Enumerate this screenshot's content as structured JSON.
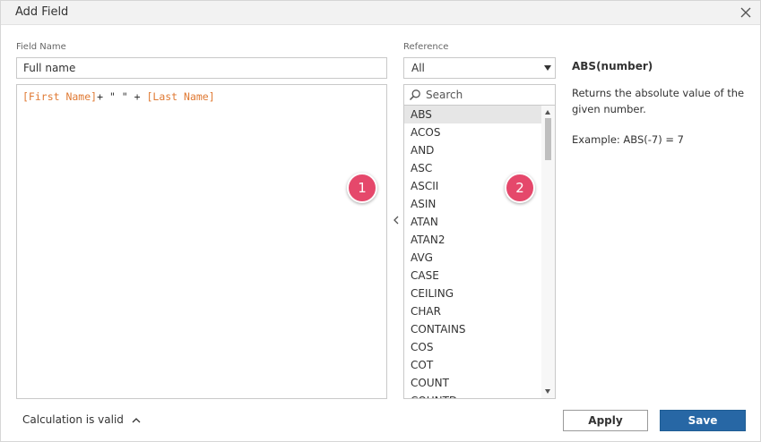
{
  "dialog": {
    "title": "Add Field",
    "close_icon": "close-icon"
  },
  "field_name": {
    "label": "Field Name",
    "value": "Full name"
  },
  "formula": {
    "ref1": "[First Name]",
    "op1": "+ \" \" + ",
    "ref2": "[Last Name]"
  },
  "callouts": {
    "one": "1",
    "two": "2"
  },
  "reference": {
    "label": "Reference",
    "selected": "All",
    "search_placeholder": "Search",
    "search_icon": "search-icon",
    "functions": [
      "ABS",
      "ACOS",
      "AND",
      "ASC",
      "ASCII",
      "ASIN",
      "ATAN",
      "ATAN2",
      "AVG",
      "CASE",
      "CEILING",
      "CHAR",
      "CONTAINS",
      "COS",
      "COT",
      "COUNT",
      "COUNTD"
    ],
    "selected_function": "ABS"
  },
  "help": {
    "title": "ABS(number)",
    "description": "Returns the absolute value of the given number.",
    "example": "Example: ABS(-7) = 7"
  },
  "footer": {
    "status": "Calculation is valid",
    "apply_label": "Apply",
    "save_label": "Save"
  },
  "colors": {
    "field_reference": "#e07a34",
    "badge": "#e5486b",
    "save_button": "#2767a5"
  }
}
